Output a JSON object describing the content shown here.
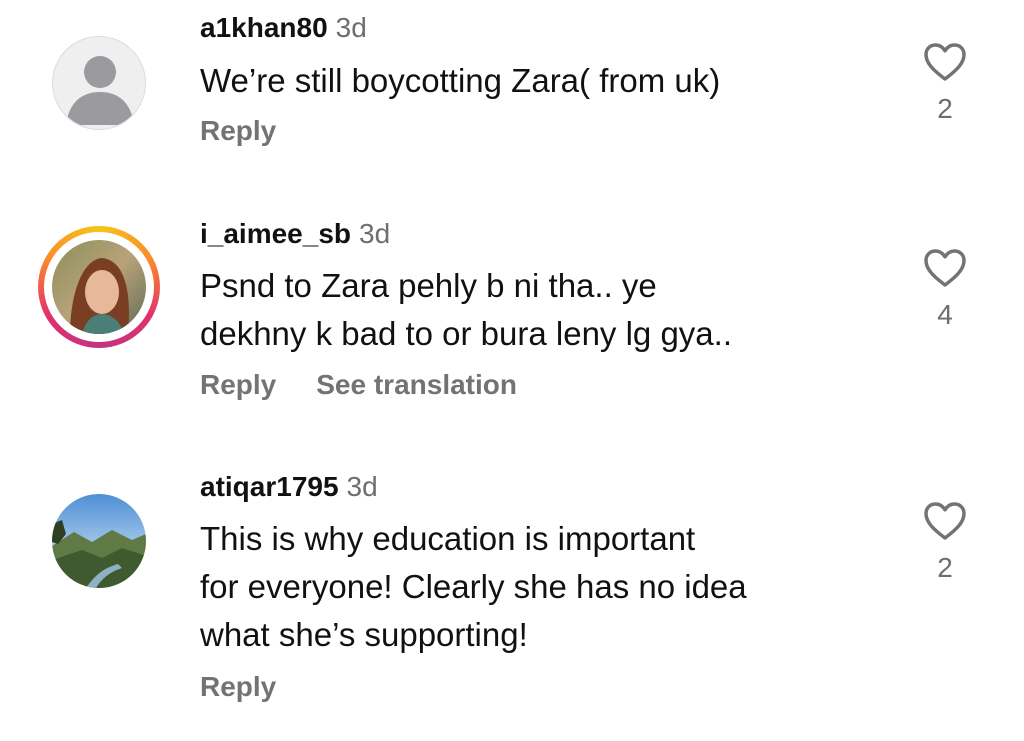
{
  "comments": [
    {
      "username": "a1khan80",
      "time": "3d",
      "text": "We’re still boycotting Zara( from uk)",
      "reply_label": "Reply",
      "likes": "2"
    },
    {
      "username": "i_aimee_sb",
      "time": "3d",
      "text_lines": [
        "Psnd to Zara pehly b ni tha.. ye",
        "dekhny k bad to or bura leny lg gya.."
      ],
      "reply_label": "Reply",
      "translation_label": "See translation",
      "likes": "4",
      "has_story_ring": true
    },
    {
      "username": "atiqar1795",
      "time": "3d",
      "text_lines": [
        "This is why education is important",
        "for everyone! Clearly she has no idea",
        "what she’s supporting!"
      ],
      "reply_label": "Reply",
      "likes": "2"
    }
  ],
  "icons": {
    "like": "heart-outline-icon",
    "default_avatar": "default-user-icon"
  },
  "colors": {
    "text": "#111111",
    "muted": "#737373",
    "ring_gradient": [
      "#f5c518",
      "#fb8c2a",
      "#e1306c",
      "#c13584"
    ]
  }
}
